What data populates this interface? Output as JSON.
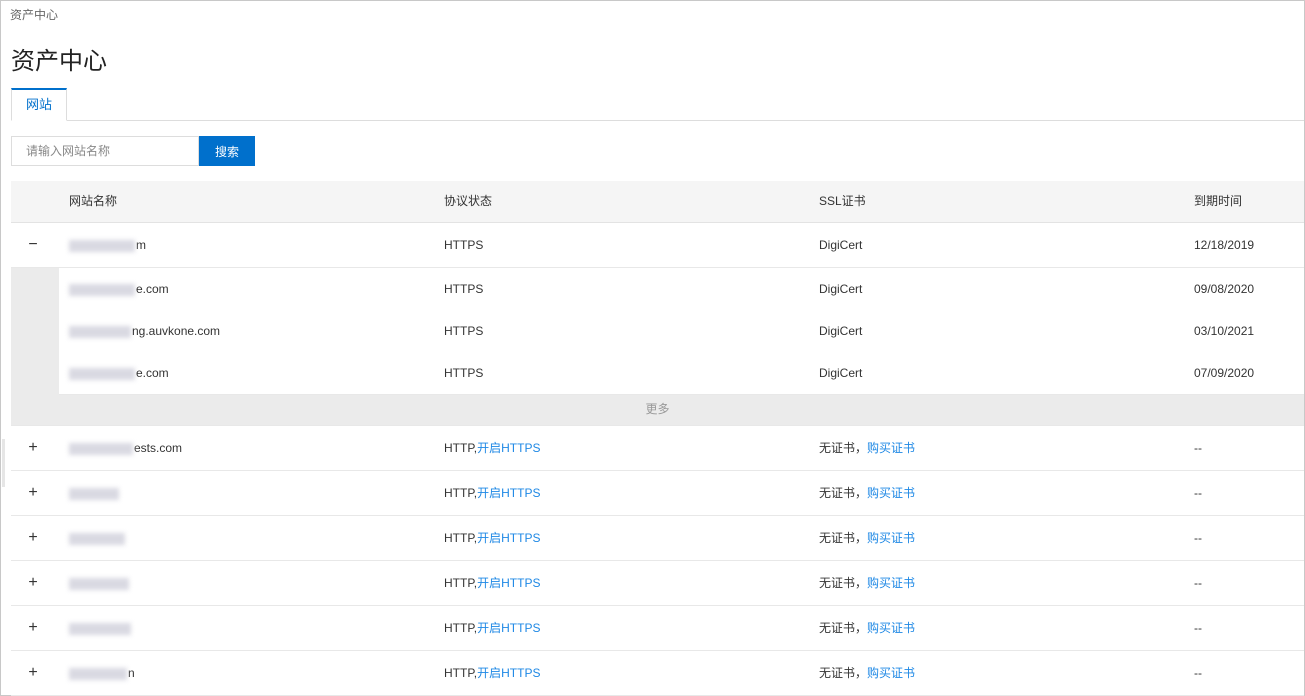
{
  "breadcrumb": "资产中心",
  "page_title": "资产中心",
  "tabs": [
    {
      "label": "网站"
    }
  ],
  "search": {
    "placeholder": "请输入网站名称",
    "button_label": "搜索"
  },
  "table": {
    "headers": [
      "网站名称",
      "协议状态",
      "SSL证书",
      "到期时间"
    ],
    "expanded_row": {
      "name_suffix": "m",
      "protocol": "HTTPS",
      "ssl": "DigiCert",
      "expiry": "12/18/2019",
      "toggle": "−"
    },
    "sub_rows": [
      {
        "name_suffix": "e.com",
        "protocol": "HTTPS",
        "ssl": "DigiCert",
        "expiry": "09/08/2020"
      },
      {
        "name_suffix": "ng.auvkone.com",
        "protocol": "HTTPS",
        "ssl": "DigiCert",
        "expiry": "03/10/2021"
      },
      {
        "name_suffix": "e.com",
        "protocol": "HTTPS",
        "ssl": "DigiCert",
        "expiry": "07/09/2020"
      }
    ],
    "more_label": "更多",
    "rows": [
      {
        "name_suffix": "ests.com",
        "protocol": "HTTP,",
        "protocol_link": "开启HTTPS",
        "ssl": "无证书，",
        "ssl_link": "购买证书",
        "expiry": "--",
        "toggle": "+"
      },
      {
        "name_suffix": "",
        "protocol": "HTTP,",
        "protocol_link": "开启HTTPS",
        "ssl": "无证书，",
        "ssl_link": "购买证书",
        "expiry": "--",
        "toggle": "+"
      },
      {
        "name_suffix": "",
        "protocol": "HTTP,",
        "protocol_link": "开启HTTPS",
        "ssl": "无证书，",
        "ssl_link": "购买证书",
        "expiry": "--",
        "toggle": "+"
      },
      {
        "name_suffix": "",
        "protocol": "HTTP,",
        "protocol_link": "开启HTTPS",
        "ssl": "无证书，",
        "ssl_link": "购买证书",
        "expiry": "--",
        "toggle": "+"
      },
      {
        "name_suffix": "",
        "protocol": "HTTP,",
        "protocol_link": "开启HTTPS",
        "ssl": "无证书，",
        "ssl_link": "购买证书",
        "expiry": "--",
        "toggle": "+"
      },
      {
        "name_suffix": "n",
        "protocol": "HTTP,",
        "protocol_link": "开启HTTPS",
        "ssl": "无证书，",
        "ssl_link": "购买证书",
        "expiry": "--",
        "toggle": "+"
      }
    ]
  },
  "colors": {
    "accent": "#0070cc",
    "link": "#1e88e5",
    "header_bg": "#f5f5f5",
    "expanded_bg": "#ebebeb"
  }
}
